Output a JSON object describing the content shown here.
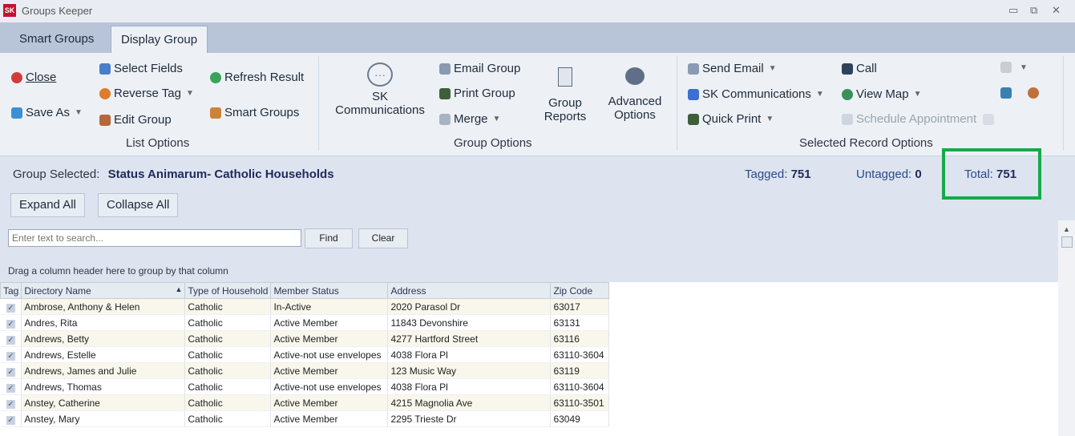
{
  "window": {
    "app_logo": "SK",
    "title": "Groups Keeper",
    "controls": [
      "▭",
      "⧉",
      "✕"
    ]
  },
  "tabs": [
    {
      "label": "Smart Groups"
    },
    {
      "label": "Display Group"
    }
  ],
  "ribbon": {
    "list_options": {
      "close": "Close",
      "save_as": "Save As",
      "select_fields": "Select Fields",
      "reverse_tag": "Reverse Tag",
      "edit_group": "Edit Group",
      "refresh_result": "Refresh Result",
      "smart_groups": "Smart Groups",
      "label": "List Options"
    },
    "group_options": {
      "sk_comm_1": "SK",
      "sk_comm_2": "Communications",
      "email_group": "Email Group",
      "print_group": "Print Group",
      "merge": "Merge",
      "reports_1": "Group",
      "reports_2": "Reports",
      "advanced_1": "Advanced",
      "advanced_2": "Options",
      "label": "Group Options"
    },
    "selected_options": {
      "send_email": "Send Email",
      "sk_communications": "SK Communications",
      "quick_print": "Quick Print",
      "call": "Call",
      "view_map": "View Map",
      "schedule_appointment": "Schedule Appointment",
      "label": "Selected Record Options"
    }
  },
  "group_info": {
    "label": "Group Selected:",
    "name": "Status Animarum- Catholic Households",
    "tagged_label": "Tagged:",
    "tagged": "751",
    "untagged_label": "Untagged:",
    "untagged": "0",
    "total_label": "Total:",
    "total": "751"
  },
  "actions": {
    "expand_all": "Expand All",
    "collapse_all": "Collapse All"
  },
  "search": {
    "placeholder": "Enter text to search...",
    "find": "Find",
    "clear": "Clear",
    "drag_hint": "Drag a column header here to group by that column"
  },
  "grid": {
    "columns": [
      "Tag",
      "Directory Name",
      "Type of Household",
      "Member Status",
      "Address",
      "Zip Code"
    ],
    "rows": [
      [
        "Ambrose, Anthony & Helen",
        "Catholic",
        "In-Active",
        "2020 Parasol Dr",
        "63017"
      ],
      [
        "Andres,  Rita",
        "Catholic",
        "Active Member",
        "11843 Devonshire",
        "63131"
      ],
      [
        "Andrews, Betty",
        "Catholic",
        "Active Member",
        "4277 Hartford Street",
        "63116"
      ],
      [
        "Andrews, Estelle",
        "Catholic",
        "Active-not use envelopes",
        "4038 Flora Pl",
        "63110-3604"
      ],
      [
        "Andrews, James and Julie",
        "Catholic",
        "Active Member",
        "123 Music Way",
        "63119"
      ],
      [
        "Andrews, Thomas",
        "Catholic",
        "Active-not use envelopes",
        "4038 Flora Pl",
        "63110-3604"
      ],
      [
        "Anstey, Catherine",
        "Catholic",
        "Active Member",
        "4215 Magnolia Ave",
        "63110-3501"
      ],
      [
        "Anstey, Mary",
        "Catholic",
        "Active Member",
        "2295 Trieste Dr",
        "63049"
      ]
    ]
  },
  "colors": {
    "accent": "#1f2a5a",
    "highlight": "#1aa84a"
  }
}
